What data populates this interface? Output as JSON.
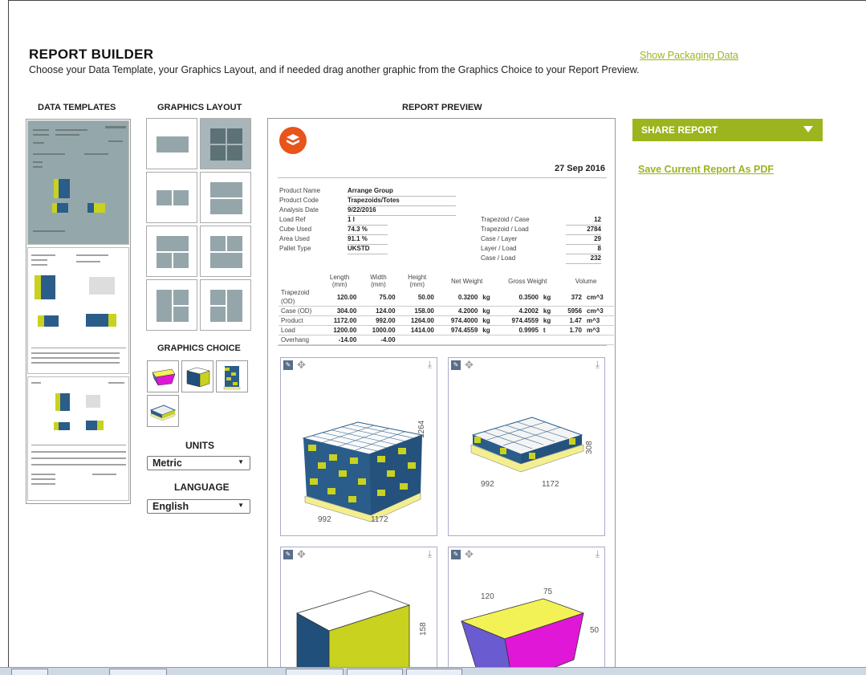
{
  "header": {
    "title": "REPORT BUILDER",
    "subtitle": "Choose your Data Template, your Graphics Layout, and if needed drag another graphic from the Graphics Choice to your Report Preview.",
    "show_packaging_link": "Show Packaging Data"
  },
  "columns": {
    "data_templates": "DATA TEMPLATES",
    "graphics_layout": "GRAPHICS LAYOUT",
    "report_preview": "REPORT PREVIEW"
  },
  "graphics_choice": {
    "heading": "GRAPHICS CHOICE"
  },
  "units": {
    "heading": "UNITS",
    "selected": "Metric"
  },
  "language": {
    "heading": "LANGUAGE",
    "selected": "English"
  },
  "share": {
    "label": "SHARE REPORT",
    "save_pdf": "Save Current Report As PDF"
  },
  "report": {
    "date": "27 Sep 2016",
    "left_fields": [
      {
        "label": "Product Name",
        "value": "Arrange Group"
      },
      {
        "label": "Product Code",
        "value": "Trapezoids/Totes"
      },
      {
        "label": "Analysis Date",
        "value": "9/22/2016"
      },
      {
        "label": "Load Ref",
        "value": "1 l"
      },
      {
        "label": "Cube Used",
        "value": "74.3 %"
      },
      {
        "label": "Area Used",
        "value": "91.1 %"
      },
      {
        "label": "Pallet Type",
        "value": "UKSTD"
      }
    ],
    "right_fields": [
      {
        "label": "Trapezoid / Case",
        "value": "12"
      },
      {
        "label": "Trapezoid / Load",
        "value": "2784"
      },
      {
        "label": "Case / Layer",
        "value": "29"
      },
      {
        "label": "Layer / Load",
        "value": "8"
      },
      {
        "label": "Case / Load",
        "value": "232"
      }
    ],
    "table": {
      "headers": [
        "",
        "Length\n(mm)",
        "Width\n(mm)",
        "Height\n(mm)",
        "Net Weight",
        "",
        "Gross Weight",
        "",
        "Volume",
        ""
      ],
      "header_cells": [
        {
          "l1": "Length",
          "l2": "(mm)"
        },
        {
          "l1": "Width",
          "l2": "(mm)"
        },
        {
          "l1": "Height",
          "l2": "(mm)"
        },
        {
          "l1": "Net Weight",
          "l2": ""
        },
        {
          "l1": "Gross Weight",
          "l2": ""
        },
        {
          "l1": "Volume",
          "l2": ""
        }
      ],
      "rows": [
        {
          "label": "Trapezoid (OD)",
          "length": "120.00",
          "width": "75.00",
          "height": "50.00",
          "net": "0.3200",
          "net_u": "kg",
          "gross": "0.3500",
          "gross_u": "kg",
          "vol": "372",
          "vol_u": "cm^3"
        },
        {
          "label": "Case (OD)",
          "length": "304.00",
          "width": "124.00",
          "height": "158.00",
          "net": "4.2000",
          "net_u": "kg",
          "gross": "4.2002",
          "gross_u": "kg",
          "vol": "5956",
          "vol_u": "cm^3"
        },
        {
          "label": "Product",
          "length": "1172.00",
          "width": "992.00",
          "height": "1264.00",
          "net": "974.4000",
          "net_u": "kg",
          "gross": "974.4559",
          "gross_u": "kg",
          "vol": "1.47",
          "vol_u": "m^3"
        },
        {
          "label": "Load",
          "length": "1200.00",
          "width": "1000.00",
          "height": "1414.00",
          "net": "974.4559",
          "net_u": "kg",
          "gross": "0.9995",
          "gross_u": "t",
          "vol": "1.70",
          "vol_u": "m^3"
        },
        {
          "label": "Overhang",
          "length": "-14.00",
          "width": "-4.00",
          "height": "",
          "net": "",
          "net_u": "",
          "gross": "",
          "gross_u": "",
          "vol": "",
          "vol_u": ""
        }
      ]
    },
    "panels": [
      {
        "dim_a": "992",
        "dim_b": "1172",
        "dim_h": "1264"
      },
      {
        "dim_a": "992",
        "dim_b": "1172",
        "dim_h": "308"
      },
      {
        "dim_a": "",
        "dim_b": "",
        "dim_h": "158"
      },
      {
        "dim_a": "120",
        "dim_b": "75",
        "dim_h": "50"
      }
    ]
  },
  "colors": {
    "accent": "#9cb41d",
    "logo": "#e8541a",
    "case_blue": "#2a5d8a",
    "case_yellow": "#c8d21f",
    "pallet": "#f3ee8f",
    "trap_yellow": "#f2f256",
    "trap_magenta": "#e017d6",
    "trap_purple": "#6b5bd0"
  }
}
